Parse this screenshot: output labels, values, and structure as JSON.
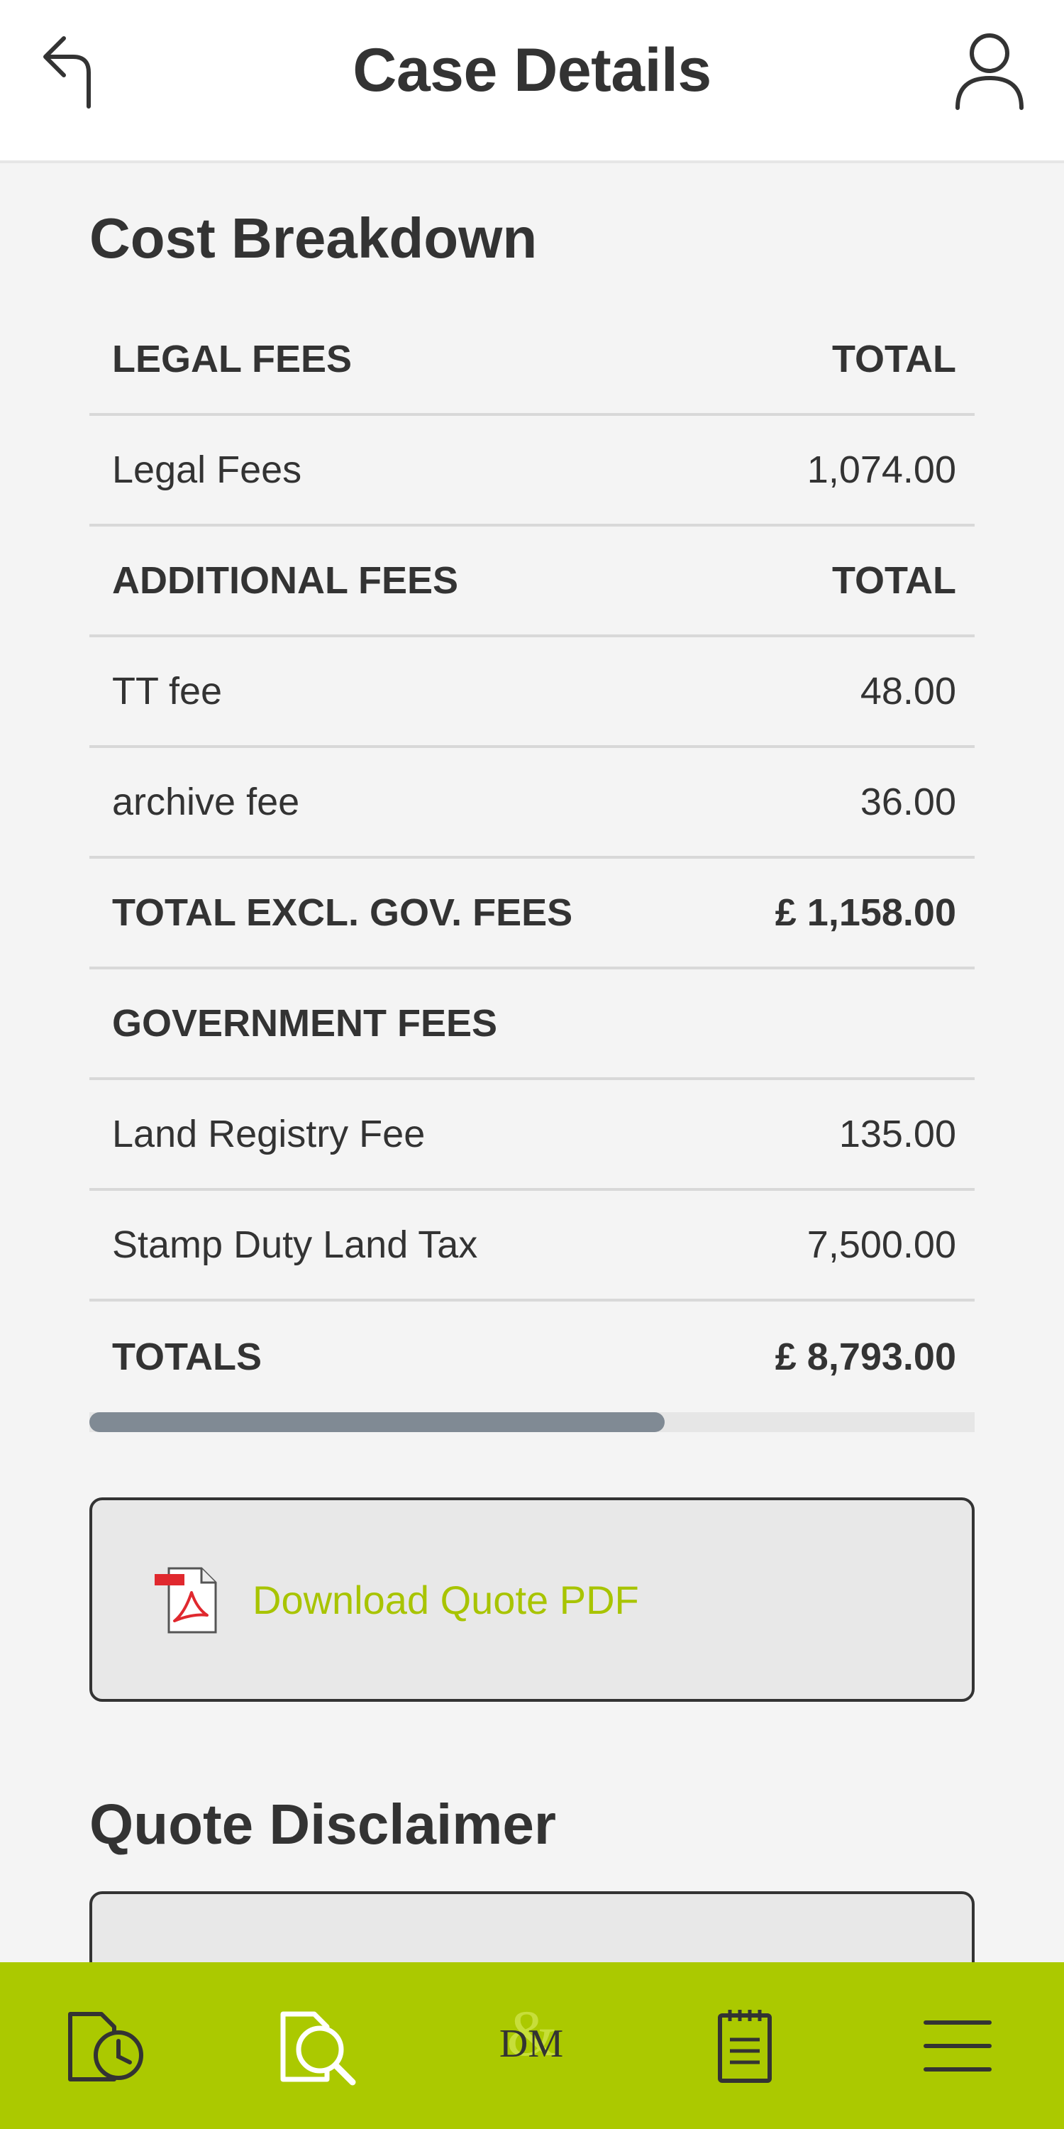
{
  "header": {
    "title": "Case Details",
    "back_icon": "back-arrow-icon",
    "profile_icon": "user-profile-icon"
  },
  "cost_breakdown": {
    "title": "Cost Breakdown",
    "rows": [
      {
        "label": "LEGAL FEES",
        "amount": "TOTAL"
      },
      {
        "label": "Legal Fees",
        "amount": "1,074.00"
      },
      {
        "label": "ADDITIONAL FEES",
        "amount": "TOTAL"
      },
      {
        "label": "TT fee",
        "amount": "48.00"
      },
      {
        "label": "archive fee",
        "amount": "36.00"
      },
      {
        "label": "TOTAL EXCL. GOV. FEES",
        "amount": "£ 1,158.00"
      },
      {
        "label": "GOVERNMENT FEES",
        "amount": ""
      },
      {
        "label": "Land Registry Fee",
        "amount": "135.00"
      },
      {
        "label": "Stamp Duty Land Tax",
        "amount": "7,500.00"
      },
      {
        "label": "TOTALS",
        "amount": "£ 8,793.00"
      }
    ],
    "scroll_position": 0.65
  },
  "download": {
    "label": "Download Quote PDF",
    "icon": "pdf-icon"
  },
  "disclaimer": {
    "title": "Quote Disclaimer"
  },
  "bottom_nav": {
    "items": [
      "case-history-icon",
      "search-document-icon",
      "dm-logo-icon",
      "notepad-icon",
      "menu-icon"
    ]
  },
  "colors": {
    "accent": "#abc900",
    "link": "#a8c400",
    "text": "#333333",
    "background": "#f4f4f4"
  }
}
